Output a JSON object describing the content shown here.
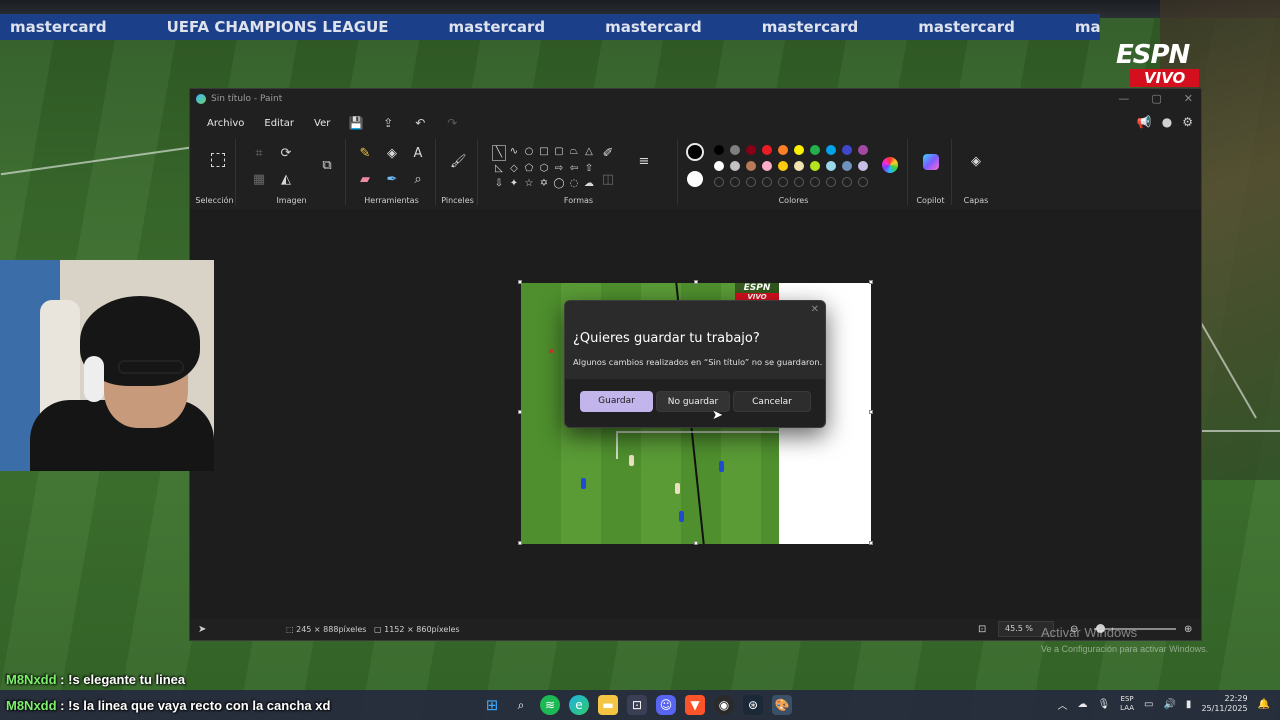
{
  "background": {
    "ad_text": [
      "mastercard",
      "UEFA CHAMPIONS LEAGUE",
      "mastercard",
      "mastercard",
      "mastercard",
      "mastercard",
      "mastercard"
    ],
    "espn_logo": "ESPN",
    "espn_live": "VIVO"
  },
  "paint": {
    "window_title": "Sin título - Paint",
    "window_controls": {
      "minimize": "—",
      "maximize": "▢",
      "close": "✕"
    },
    "menu": {
      "file": "Archivo",
      "edit": "Editar",
      "view": "Ver"
    },
    "groups": {
      "selection": "Selección",
      "image": "Imagen",
      "tools": "Herramientas",
      "brushes": "Pinceles",
      "shapes": "Formas",
      "colors": "Colores",
      "copilot": "Copilot",
      "layers": "Capas"
    },
    "palette_row1": [
      "#000000",
      "#7f7f7f",
      "#880015",
      "#ed1c24",
      "#ff7f27",
      "#fff200",
      "#22b14c",
      "#00a2e8",
      "#3f48cc",
      "#a349a4"
    ],
    "palette_row2": [
      "#ffffff",
      "#c3c3c3",
      "#b97a57",
      "#ffaec9",
      "#ffc90e",
      "#efe4b0",
      "#b5e61d",
      "#99d9ea",
      "#7092be",
      "#c8bfe7"
    ],
    "canvas_mini_logo": "ESPN",
    "canvas_mini_live": "VIVO",
    "status": {
      "selection_size": "245 × 888píxeles",
      "canvas_size": "1152 × 860píxeles",
      "zoom": "45.5 %"
    }
  },
  "dialog": {
    "title": "¿Quieres guardar tu trabajo?",
    "message": "Algunos cambios realizados en “Sin título” no se guardaron.",
    "save": "Guardar",
    "dont_save": "No guardar",
    "cancel": "Cancelar"
  },
  "chat": [
    {
      "user": "M8Nxdd",
      "text": " : !s elegante tu linea"
    },
    {
      "user": "M8Nxdd",
      "text": " : !s la linea que vaya recto con la cancha xd"
    }
  ],
  "watermark": {
    "line1": "Activar Windows",
    "line2": "Ve a Configuración para activar Windows."
  },
  "taskbar": {
    "lang_1": "ESP",
    "lang_2": "LAA",
    "time": "22:29",
    "date": "25/11/2025"
  }
}
